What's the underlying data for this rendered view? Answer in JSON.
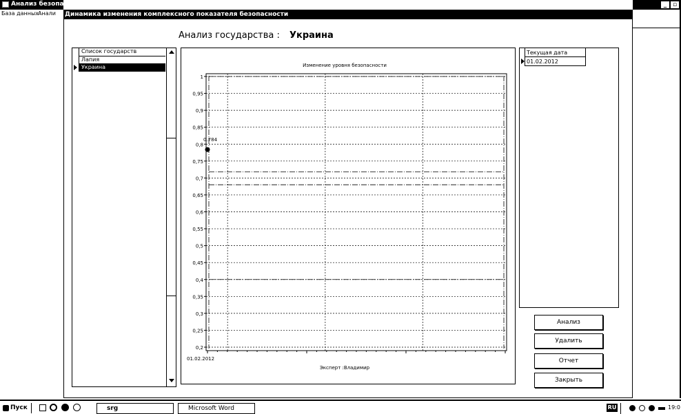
{
  "app": {
    "title": "Анализ безопас",
    "menu": [
      "База данных",
      "Анали"
    ]
  },
  "dialog": {
    "title": "Динамика изменения комплексного показателя безопасности",
    "heading_label": "Анализ государства :",
    "heading_value": "Украина"
  },
  "countries": {
    "header": "Список государств",
    "rows": [
      {
        "name": "Лапия",
        "selected": false
      },
      {
        "name": "Украина",
        "selected": true
      }
    ]
  },
  "dates": {
    "header": "Текущая дата",
    "rows": [
      "01.02.2012"
    ]
  },
  "chart_data": {
    "type": "scatter",
    "title": "Изменение уровня безопасности",
    "footer": "Эксперт :Владимир",
    "x": [
      "01.02.2012"
    ],
    "y": [
      0.784
    ],
    "point_label": "0.784",
    "ylim": [
      0.2,
      1
    ],
    "yticks": [
      "1",
      "0,95",
      "0,9",
      "0,85",
      "0,8",
      "0,75",
      "0,7",
      "0,65",
      "0,6",
      "0,55",
      "0,5",
      "0,45",
      "0,4",
      "0,35",
      "0,3",
      "0,25",
      "0,2"
    ],
    "grid": true,
    "reference_lines": [
      0.718,
      0.68,
      0.4
    ]
  },
  "buttons": {
    "analyze": "Анализ",
    "delete": "Удалить",
    "report": "Отчет",
    "close": "Закрыть"
  },
  "taskbar": {
    "start": "Пуск",
    "tasks": [
      "srg",
      "Microsoft Word"
    ],
    "lang": "RU",
    "clock": "19:0"
  },
  "icons": [
    "app-icon",
    "scroll-up-arrow-icon",
    "scroll-down-arrow-icon",
    "row-pointer-icon",
    "start-icon",
    "save-icon",
    "browser-icon",
    "media-icon",
    "tray-icon"
  ]
}
